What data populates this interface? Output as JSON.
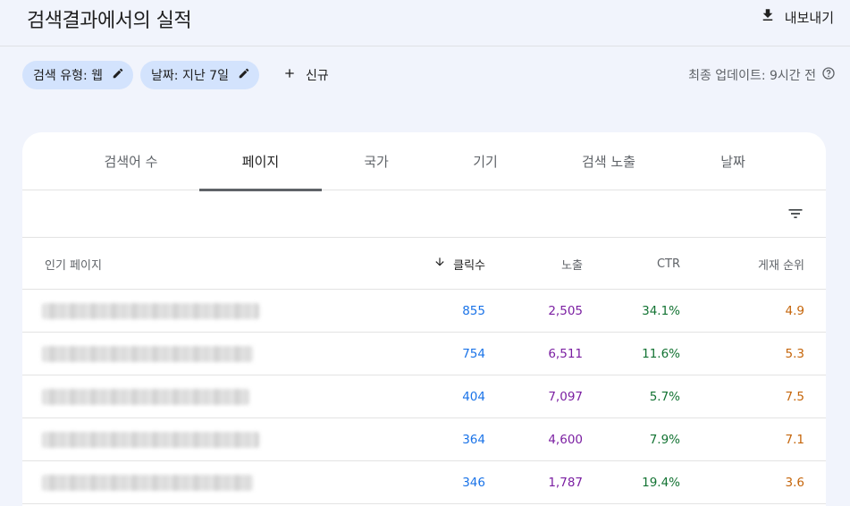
{
  "header": {
    "title": "검색결과에서의 실적",
    "export_label": "내보내기"
  },
  "filters": {
    "chips": [
      {
        "label": "검색 유형: 웹"
      },
      {
        "label": "날짜: 지난 7일"
      }
    ],
    "new_label": "신규",
    "updated_text": "최종 업데이트: 9시간 전"
  },
  "tabs": [
    {
      "label": "검색어 수",
      "active": false
    },
    {
      "label": "페이지",
      "active": true
    },
    {
      "label": "국가",
      "active": false
    },
    {
      "label": "기기",
      "active": false
    },
    {
      "label": "검색 노출",
      "active": false
    },
    {
      "label": "날짜",
      "active": false
    }
  ],
  "table": {
    "columns": {
      "page": "인기 페이지",
      "clicks": "클릭수",
      "impressions": "노출",
      "ctr": "CTR",
      "position": "게재 순위"
    },
    "rows": [
      {
        "clicks": "855",
        "impressions": "2,505",
        "ctr": "34.1%",
        "position": "4.9"
      },
      {
        "clicks": "754",
        "impressions": "6,511",
        "ctr": "11.6%",
        "position": "5.3"
      },
      {
        "clicks": "404",
        "impressions": "7,097",
        "ctr": "5.7%",
        "position": "7.5"
      },
      {
        "clicks": "364",
        "impressions": "4,600",
        "ctr": "7.9%",
        "position": "7.1"
      },
      {
        "clicks": "346",
        "impressions": "1,787",
        "ctr": "19.4%",
        "position": "3.6"
      }
    ]
  },
  "colors": {
    "clicks": "#1a73e8",
    "impressions": "#7b1fa2",
    "ctr": "#137333",
    "position": "#c5650a",
    "chip_bg": "#d3e3fd",
    "page_bg": "#f1f4fc"
  },
  "icons": {
    "export": "download-icon",
    "edit": "pencil-icon",
    "new": "plus-icon",
    "help": "help-circle-icon",
    "filter": "filter-list-icon",
    "sort": "arrow-down-icon"
  }
}
